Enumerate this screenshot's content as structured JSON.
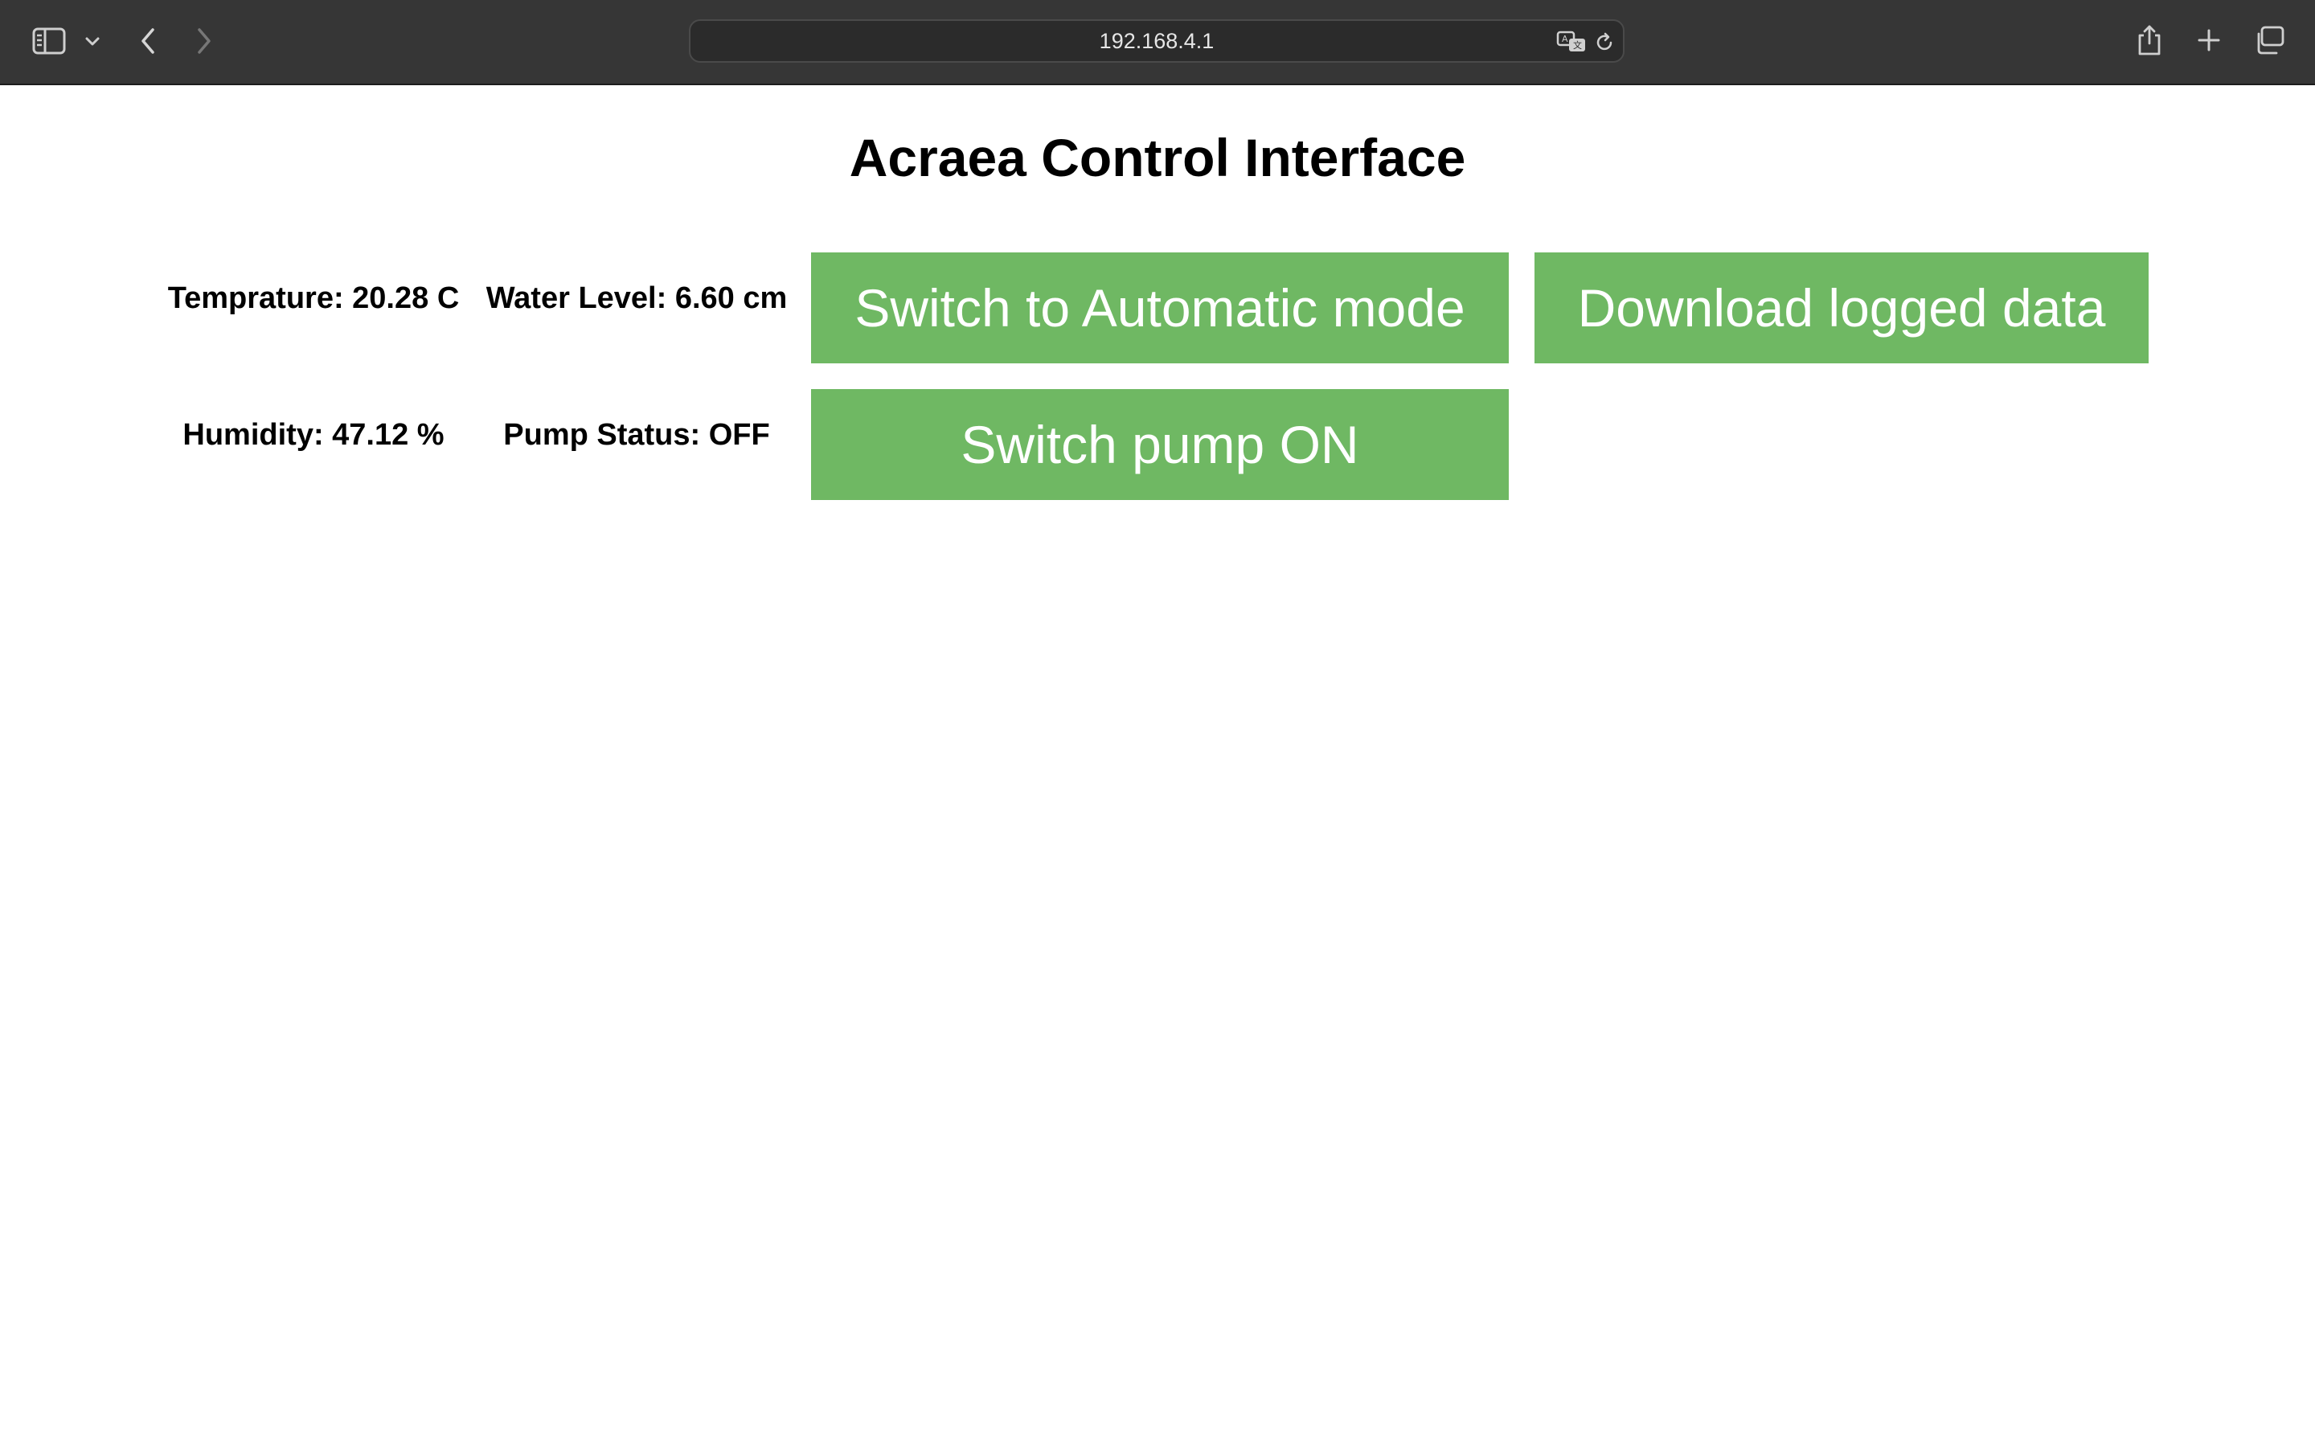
{
  "browser": {
    "url": "192.168.4.1",
    "icons": {
      "sidebar": "sidebar-icon",
      "dropdown": "chevron-down-icon",
      "back": "chevron-left-icon",
      "forward": "chevron-right-icon",
      "translate": "translate-icon",
      "reload": "reload-icon",
      "share": "share-icon",
      "new_tab": "plus-icon",
      "tabs": "tabs-overview-icon"
    }
  },
  "page": {
    "title": "Acraea Control Interface",
    "stats": {
      "temperature": "Temprature: 20.28 C",
      "water_level": "Water Level: 6.60 cm",
      "humidity": "Humidity: 47.12 %",
      "pump_status": "Pump Status: OFF"
    },
    "buttons": {
      "mode": "Switch to Automatic mode",
      "download": "Download logged data",
      "pump": "Switch pump ON"
    },
    "colors": {
      "button_bg": "#6fb863",
      "button_text": "#ffffff",
      "toolbar_bg": "#363636"
    }
  }
}
